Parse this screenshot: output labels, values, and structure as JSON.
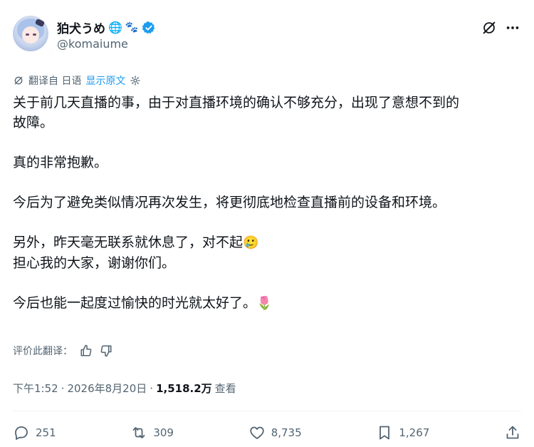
{
  "user": {
    "display_name": "狛犬うめ",
    "globe_emoji": "🌐",
    "paw_emoji": "🐾",
    "handle": "@komaiume"
  },
  "translation": {
    "label": "翻译自 日语",
    "show_original": "显示原文"
  },
  "post": {
    "line1": "关于前几天直播的事，由于对直播环境的确认不够充分，出现了意想不到的",
    "line2": "故障。",
    "line3": "真的非常抱歉。",
    "line4": "今后为了避免类似情况再次发生，将更彻底地检查直播前的设备和环境。",
    "line5": "另外，昨天毫无联系就休息了，对不起",
    "line5_emoji": "🥲",
    "line6": "担心我的大家，谢谢你们。",
    "line7": "今后也能一起度过愉快的时光就太好了。",
    "line7_emoji": "🌷"
  },
  "rating": {
    "label": "评价此翻译："
  },
  "meta": {
    "time": "下午1:52",
    "sep1": "·",
    "date": "2026年8月20日",
    "sep2": "·",
    "views": "1,518.2万",
    "views_label": "查看"
  },
  "actions": {
    "replies": "251",
    "reposts": "309",
    "likes": "8,735",
    "bookmarks": "1,267"
  },
  "colors": {
    "accent": "#1d9bf0",
    "secondary_text": "#536471",
    "primary_text": "#0f1419"
  }
}
